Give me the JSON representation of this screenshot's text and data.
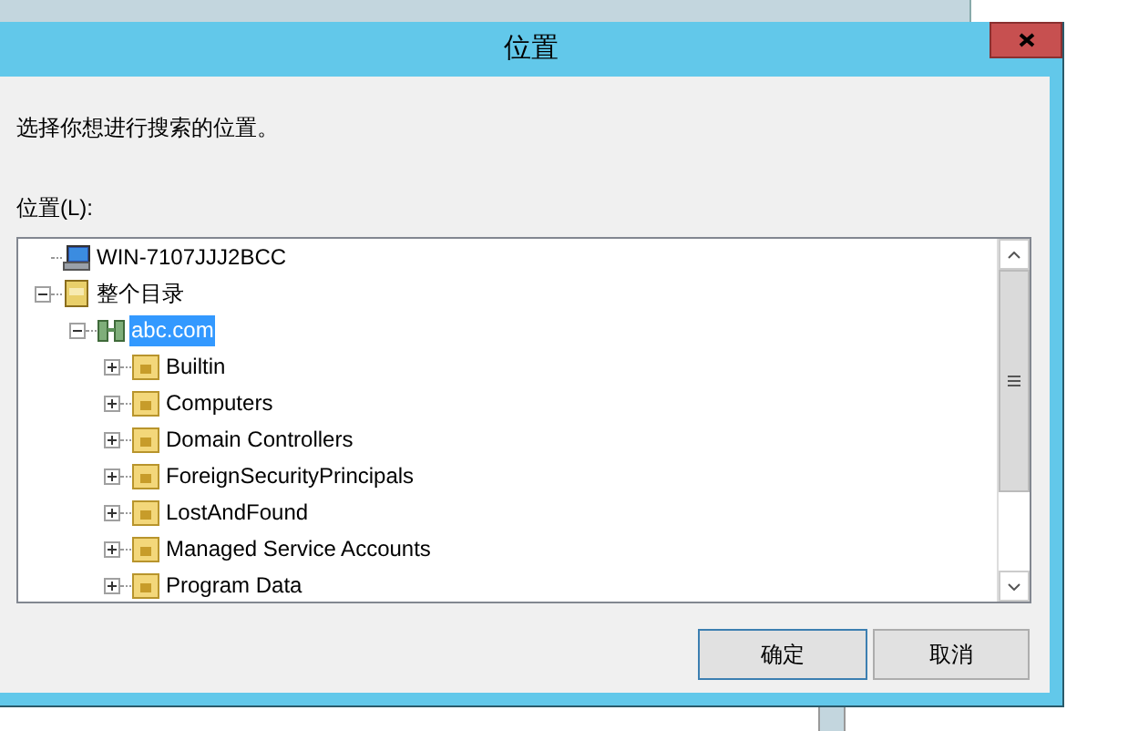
{
  "window": {
    "title": "位置"
  },
  "prompt": "选择你想进行搜索的位置。",
  "location_label": "位置(L):",
  "tree": [
    {
      "kind": "computer",
      "label": "WIN-7107JJJ2BCC",
      "selected": false
    },
    {
      "kind": "directory",
      "label": "整个目录",
      "selected": false,
      "expanded": true,
      "children": [
        {
          "kind": "domain",
          "label": "abc.com",
          "selected": true,
          "expanded": true,
          "children": [
            {
              "kind": "folder",
              "label": "Builtin",
              "selected": false,
              "expanded": false
            },
            {
              "kind": "folder",
              "label": "Computers",
              "selected": false,
              "expanded": false
            },
            {
              "kind": "folder",
              "label": "Domain Controllers",
              "selected": false,
              "expanded": false
            },
            {
              "kind": "folder",
              "label": "ForeignSecurityPrincipals",
              "selected": false,
              "expanded": false
            },
            {
              "kind": "folder",
              "label": "LostAndFound",
              "selected": false,
              "expanded": false
            },
            {
              "kind": "folder",
              "label": "Managed Service Accounts",
              "selected": false,
              "expanded": false
            },
            {
              "kind": "folder",
              "label": "Program Data",
              "selected": false,
              "expanded": false
            }
          ]
        }
      ]
    }
  ],
  "buttons": [
    {
      "label": "确定",
      "default": true
    },
    {
      "label": "取消",
      "default": false
    }
  ]
}
